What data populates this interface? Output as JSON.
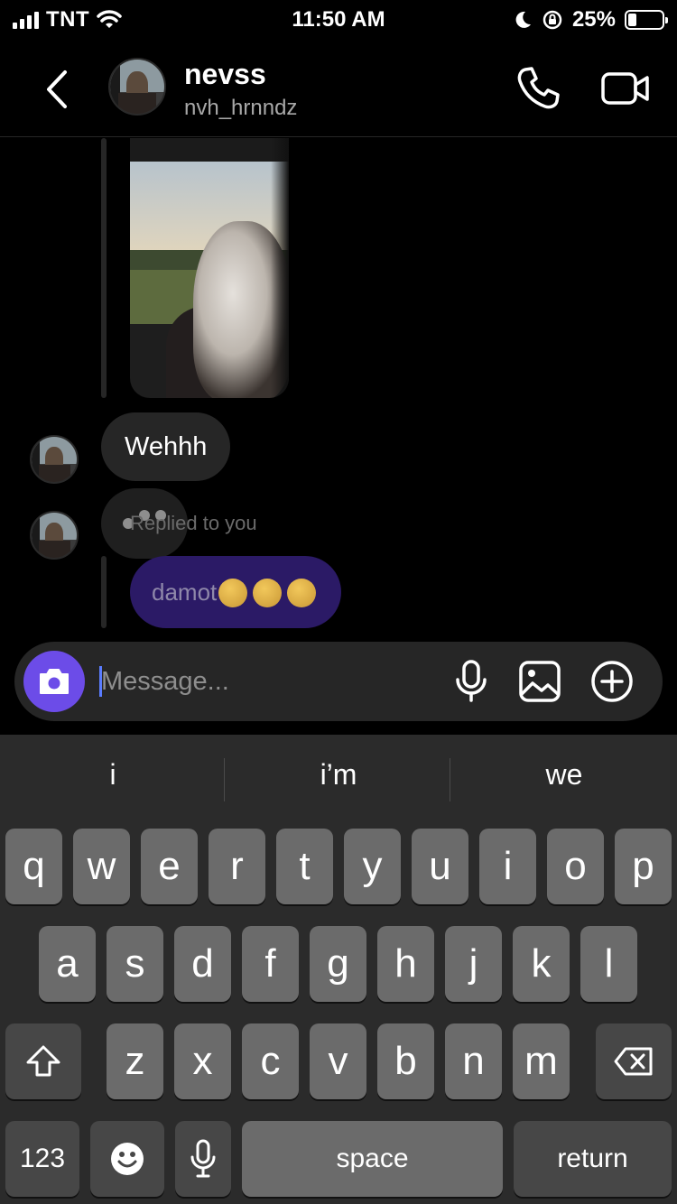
{
  "status_bar": {
    "carrier": "TNT",
    "time": "11:50 AM",
    "battery_percent": "25%",
    "battery_level": 0.25,
    "icons": [
      "signal-icon",
      "wifi-icon",
      "moon-icon",
      "orientation-lock-icon",
      "battery-icon"
    ]
  },
  "header": {
    "name": "nevss",
    "username": "nvh_hrnndz",
    "icons": [
      "back-chevron-icon",
      "phone-icon",
      "video-camera-icon"
    ]
  },
  "conversation": {
    "incoming_message": "Wehhh",
    "reply_label": "Replied to you",
    "outgoing_message": "damot",
    "outgoing_emojis": [
      "pensive-face",
      "pensive-face",
      "pensive-face"
    ]
  },
  "composer": {
    "placeholder": "Message...",
    "icons": [
      "camera-icon",
      "microphone-icon",
      "image-icon",
      "plus-circle-icon"
    ]
  },
  "keyboard": {
    "suggestions": [
      "i",
      "i’m",
      "we"
    ],
    "row1": [
      "q",
      "w",
      "e",
      "r",
      "t",
      "y",
      "u",
      "i",
      "o",
      "p"
    ],
    "row2": [
      "a",
      "s",
      "d",
      "f",
      "g",
      "h",
      "j",
      "k",
      "l"
    ],
    "row3": [
      "z",
      "x",
      "c",
      "v",
      "b",
      "n",
      "m"
    ],
    "numbers_label": "123",
    "space_label": "space",
    "return_label": "return"
  },
  "colors": {
    "background": "#000000",
    "bubble_incoming": "#262626",
    "bubble_outgoing": "#2b1a66",
    "camera_button": "#6c4ce8",
    "keyboard_bg": "#2b2b2b",
    "key": "#6b6b6b",
    "key_dark": "#474747"
  }
}
